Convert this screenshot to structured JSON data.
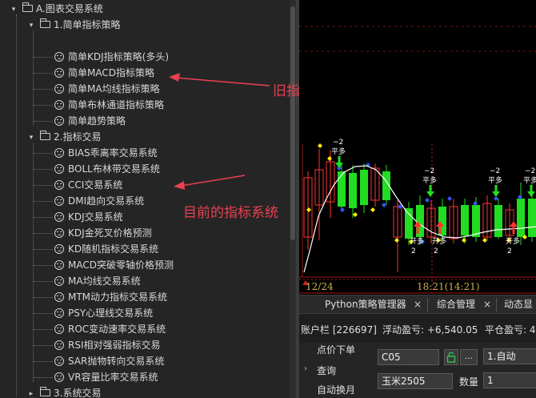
{
  "tree": {
    "root": "A.图表交易系统",
    "groups": [
      {
        "label": "1.简单指标策略",
        "items": [
          "简单KDJ指标策略(多头)",
          "简单MACD指标策略",
          "简单MA均线指标策略",
          "简单布林通道指标策略",
          "简单趋势策略"
        ]
      },
      {
        "label": "2.指标交易",
        "items": [
          "BIAS乖离率交易系统",
          "BOLL布林带交易系统",
          "CCI交易系统",
          "DMI趋向交易系统",
          "KDJ交易系统",
          "KDJ金死叉价格预测",
          "KD随机指标交易系统",
          "MACD突破零轴价格预测",
          "MA均线交易系统",
          "MTM动力指标交易系统",
          "PSY心理线交易系统",
          "ROC变动速率交易系统",
          "RSI相对强弱指标交易",
          "SAR抛物转向交易系统",
          "VR容量比率交易系统"
        ]
      },
      {
        "label": "3.系统交易",
        "items": []
      }
    ]
  },
  "annotations": {
    "old": "旧指标系统",
    "current": "目前的指标系统"
  },
  "chart": {
    "date_left": "12/24",
    "date_right": "18:21(14:21)",
    "signals": [
      {
        "kind": "sell",
        "qty": "−2",
        "label": "平多"
      },
      {
        "kind": "sell",
        "qty": "−2",
        "label": "平多"
      },
      {
        "kind": "sell",
        "qty": "−2",
        "label": "平多"
      },
      {
        "kind": "sell",
        "qty": "−2",
        "label": "平多"
      },
      {
        "kind": "buy",
        "qty": "2",
        "label": "开多"
      },
      {
        "kind": "buy",
        "qty": "2",
        "label": "开多"
      },
      {
        "kind": "buy",
        "qty": "2",
        "label": "开多"
      }
    ],
    "colors": {
      "up": "#ff3333",
      "down": "#22dd22",
      "ma": "#ffffff",
      "dot_up": "#ffee00",
      "dot_down": "#3355ff"
    }
  },
  "tabs": [
    {
      "label": "Python策略管理器",
      "close": "×"
    },
    {
      "label": "综合管理",
      "close": "×"
    },
    {
      "label": "动态显"
    }
  ],
  "account": {
    "id": "账户栏 [226697]",
    "float_pl": "浮动盈亏: +6,540.05",
    "close_pl": "平仓盈亏: 4"
  },
  "order": {
    "menu": [
      "点价下单",
      "查询",
      "自动换月"
    ],
    "contract": "C05",
    "mode": "1.自动",
    "product": "玉米2505",
    "qty_label": "数量",
    "qty_value": "1",
    "more": "..."
  }
}
